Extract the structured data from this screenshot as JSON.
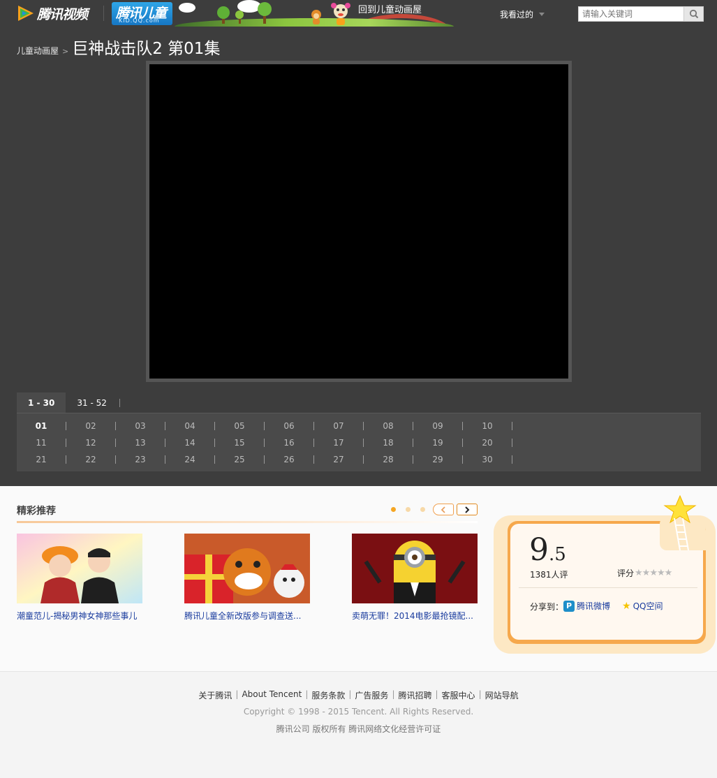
{
  "header": {
    "brand": "腾讯视频",
    "kid_brand": "腾讯儿童",
    "kid_domain": "KID.QQ.com",
    "back_link": "回到儿童动画屋",
    "history": "我看过的",
    "search_placeholder": "请输入关键词"
  },
  "breadcrumb": {
    "parent": "儿童动画屋",
    "separator": ">",
    "title": "巨神战击队2 第01集"
  },
  "episodes": {
    "tabs": [
      "1 - 30",
      "31 - 52"
    ],
    "active_tab": "1 - 30",
    "current": "01",
    "rows": [
      [
        "01",
        "02",
        "03",
        "04",
        "05",
        "06",
        "07",
        "08",
        "09",
        "10"
      ],
      [
        "11",
        "12",
        "13",
        "14",
        "15",
        "16",
        "17",
        "18",
        "19",
        "20"
      ],
      [
        "21",
        "22",
        "23",
        "24",
        "25",
        "26",
        "27",
        "28",
        "29",
        "30"
      ]
    ]
  },
  "recommend": {
    "title": "精彩推荐",
    "items": [
      {
        "caption": "潮童范儿-揭秘男神女神那些事儿"
      },
      {
        "caption": "腾讯儿童全新改版参与调查送..."
      },
      {
        "caption": "卖萌无罪！2014电影最抢镜配..."
      }
    ]
  },
  "rating": {
    "score_int": "9",
    "score_dec": ".5",
    "count": "1381人评",
    "label": "评分",
    "stars": "★★★★★",
    "share_label": "分享到：",
    "weibo": "腾讯微博",
    "qzone": "QQ空间"
  },
  "footer": {
    "links": [
      "关于腾讯",
      "About Tencent",
      "服务条款",
      "广告服务",
      "腾讯招聘",
      "客服中心",
      "网站导航"
    ],
    "copyright": "Copyright © 1998 - 2015 Tencent. All Rights Reserved.",
    "license": "腾讯公司 版权所有 腾讯网络文化经营许可证"
  },
  "colors": {
    "top_bg": "#3d3d3d",
    "accent_orange": "#f5a623",
    "link_blue": "#1a3c9e"
  }
}
